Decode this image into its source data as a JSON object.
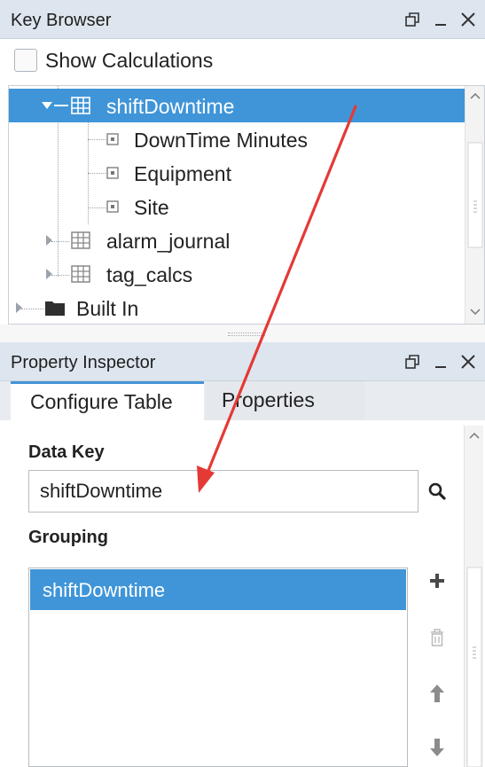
{
  "key_browser": {
    "title": "Key Browser",
    "show_calculations_label": "Show Calculations",
    "tree": {
      "shift_downtime": "shiftDowntime",
      "children": [
        "DownTime Minutes",
        "Equipment",
        "Site"
      ],
      "alarm_journal": "alarm_journal",
      "tag_calcs": "tag_calcs",
      "built_in": "Built In"
    }
  },
  "property_inspector": {
    "title": "Property Inspector",
    "tabs": [
      "Configure Table",
      "Properties"
    ],
    "data_key_label": "Data Key",
    "data_key_value": "shiftDowntime",
    "grouping_label": "Grouping",
    "grouping_items": [
      "shiftDowntime"
    ]
  },
  "colors": {
    "selection": "#3f95d8",
    "header": "#dde6ef",
    "annotation_arrow": "#e53935"
  },
  "icons": [
    "restore-icon",
    "minimize-icon",
    "close-icon",
    "table-icon",
    "column-icon",
    "folder-icon",
    "search-icon",
    "add-icon",
    "delete-icon",
    "move-up-icon",
    "move-down-icon"
  ]
}
